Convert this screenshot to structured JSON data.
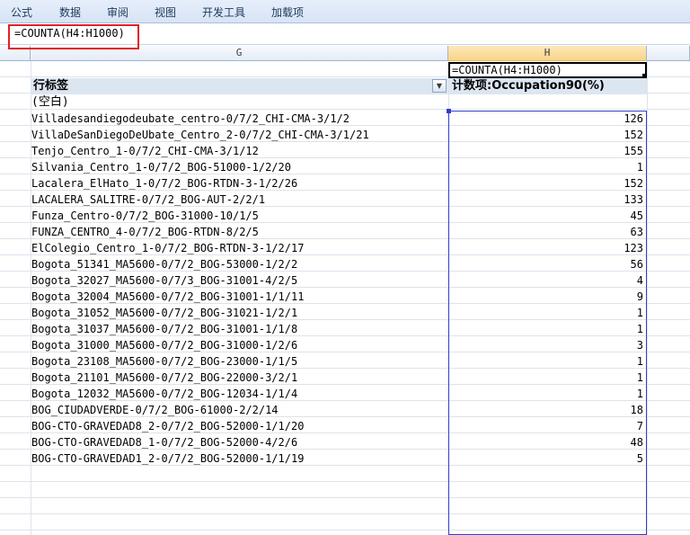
{
  "ribbon": {
    "tabs": [
      "公式",
      "数据",
      "审阅",
      "视图",
      "开发工具",
      "加载项"
    ]
  },
  "formula_bar": {
    "formula": "=COUNTA(H4:H1000)"
  },
  "columns": {
    "g_label": "G",
    "h_label": "H"
  },
  "edit_cell": {
    "formula": "=COUNTA(H4:H1000)"
  },
  "pivot": {
    "row_label_header": "行标签",
    "value_header": "计数项:Occupation90(%)",
    "blank_label": "(空白)",
    "rows": [
      {
        "label": "Villadesandiegodeubate_centro-0/7/2_CHI-CMA-3/1/2",
        "value": "126"
      },
      {
        "label": "VillaDeSanDiegoDeUbate_Centro_2-0/7/2_CHI-CMA-3/1/21",
        "value": "152"
      },
      {
        "label": "Tenjo_Centro_1-0/7/2_CHI-CMA-3/1/12",
        "value": "155"
      },
      {
        "label": "Silvania_Centro_1-0/7/2_BOG-51000-1/2/20",
        "value": "1"
      },
      {
        "label": "Lacalera_ElHato_1-0/7/2_BOG-RTDN-3-1/2/26",
        "value": "152"
      },
      {
        "label": "LACALERA_SALITRE-0/7/2_BOG-AUT-2/2/1",
        "value": "133"
      },
      {
        "label": "Funza_Centro-0/7/2_BOG-31000-10/1/5",
        "value": "45"
      },
      {
        "label": "FUNZA_CENTRO_4-0/7/2_BOG-RTDN-8/2/5",
        "value": "63"
      },
      {
        "label": "ElColegio_Centro_1-0/7/2_BOG-RTDN-3-1/2/17",
        "value": "123"
      },
      {
        "label": "Bogota_51341_MA5600-0/7/2_BOG-53000-1/2/2",
        "value": "56"
      },
      {
        "label": "Bogota_32027_MA5600-0/7/3_BOG-31001-4/2/5",
        "value": "4"
      },
      {
        "label": "Bogota_32004_MA5600-0/7/2_BOG-31001-1/1/11",
        "value": "9"
      },
      {
        "label": "Bogota_31052_MA5600-0/7/2_BOG-31021-1/2/1",
        "value": "1"
      },
      {
        "label": "Bogota_31037_MA5600-0/7/2_BOG-31001-1/1/8",
        "value": "1"
      },
      {
        "label": "Bogota_31000_MA5600-0/7/2_BOG-31000-1/2/6",
        "value": "3"
      },
      {
        "label": "Bogota_23108_MA5600-0/7/2_BOG-23000-1/1/5",
        "value": "1"
      },
      {
        "label": "Bogota_21101_MA5600-0/7/2_BOG-22000-3/2/1",
        "value": "1"
      },
      {
        "label": "Bogota_12032_MA5600-0/7/2_BOG-12034-1/1/4",
        "value": "1"
      },
      {
        "label": "BOG_CIUDADVERDE-0/7/2_BOG-61000-2/2/14",
        "value": "18"
      },
      {
        "label": "BOG-CTO-GRAVEDAD8_2-0/7/2_BOG-52000-1/1/20",
        "value": "7"
      },
      {
        "label": "BOG-CTO-GRAVEDAD8_1-0/7/2_BOG-52000-4/2/6",
        "value": "48"
      },
      {
        "label": "BOG-CTO-GRAVEDAD1_2-0/7/2_BOG-52000-1/1/19",
        "value": "5"
      }
    ]
  }
}
